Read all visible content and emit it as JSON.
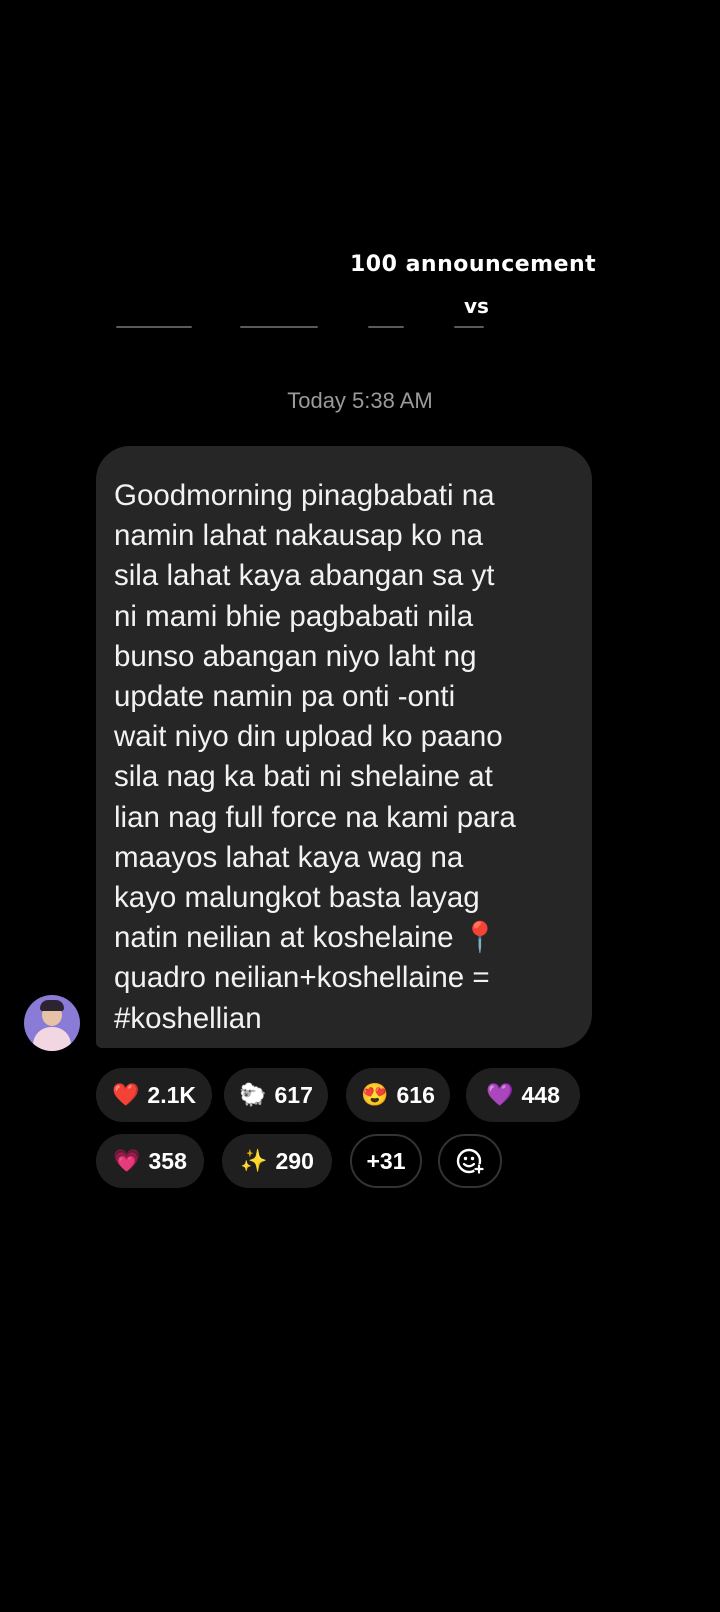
{
  "overlay": {
    "title": "100 announcement",
    "subtitle": "vs"
  },
  "chat": {
    "timestamp": "Today 5:38 AM",
    "message": "Goodmorning pinagbabati na\nnamin lahat nakausap ko na\nsila lahat kaya abangan sa yt\nni mami bhie pagbabati nila\nbunso abangan niyo laht ng\nupdate namin pa onti -onti\nwait niyo din upload ko paano\nsila nag ka bati ni shelaine at\nlian nag full force na kami para\nmaayos lahat kaya wag na\nkayo malungkot basta layag\nnatin neilian at koshelaine 📍\nquadro neilian+koshellaine =\n#koshellian"
  },
  "reactions": [
    {
      "emoji": "❤️",
      "count": "2.1K",
      "icon": "red-heart-icon"
    },
    {
      "emoji": "🐑",
      "count": "617",
      "icon": "sheep-icon"
    },
    {
      "emoji": "😍",
      "count": "616",
      "icon": "heart-eyes-icon"
    },
    {
      "emoji": "💜",
      "count": "448",
      "icon": "purple-heart-icon"
    },
    {
      "emoji": "💗",
      "count": "358",
      "icon": "growing-heart-icon"
    },
    {
      "emoji": "✨",
      "count": "290",
      "icon": "sparkles-icon"
    }
  ],
  "more_reactions": "+31",
  "add_reaction_icon": "add-reaction-icon",
  "colors": {
    "background": "#000000",
    "bubble": "#262626",
    "pill": "#1f1f1f",
    "timestamp": "#9a9a9a"
  }
}
